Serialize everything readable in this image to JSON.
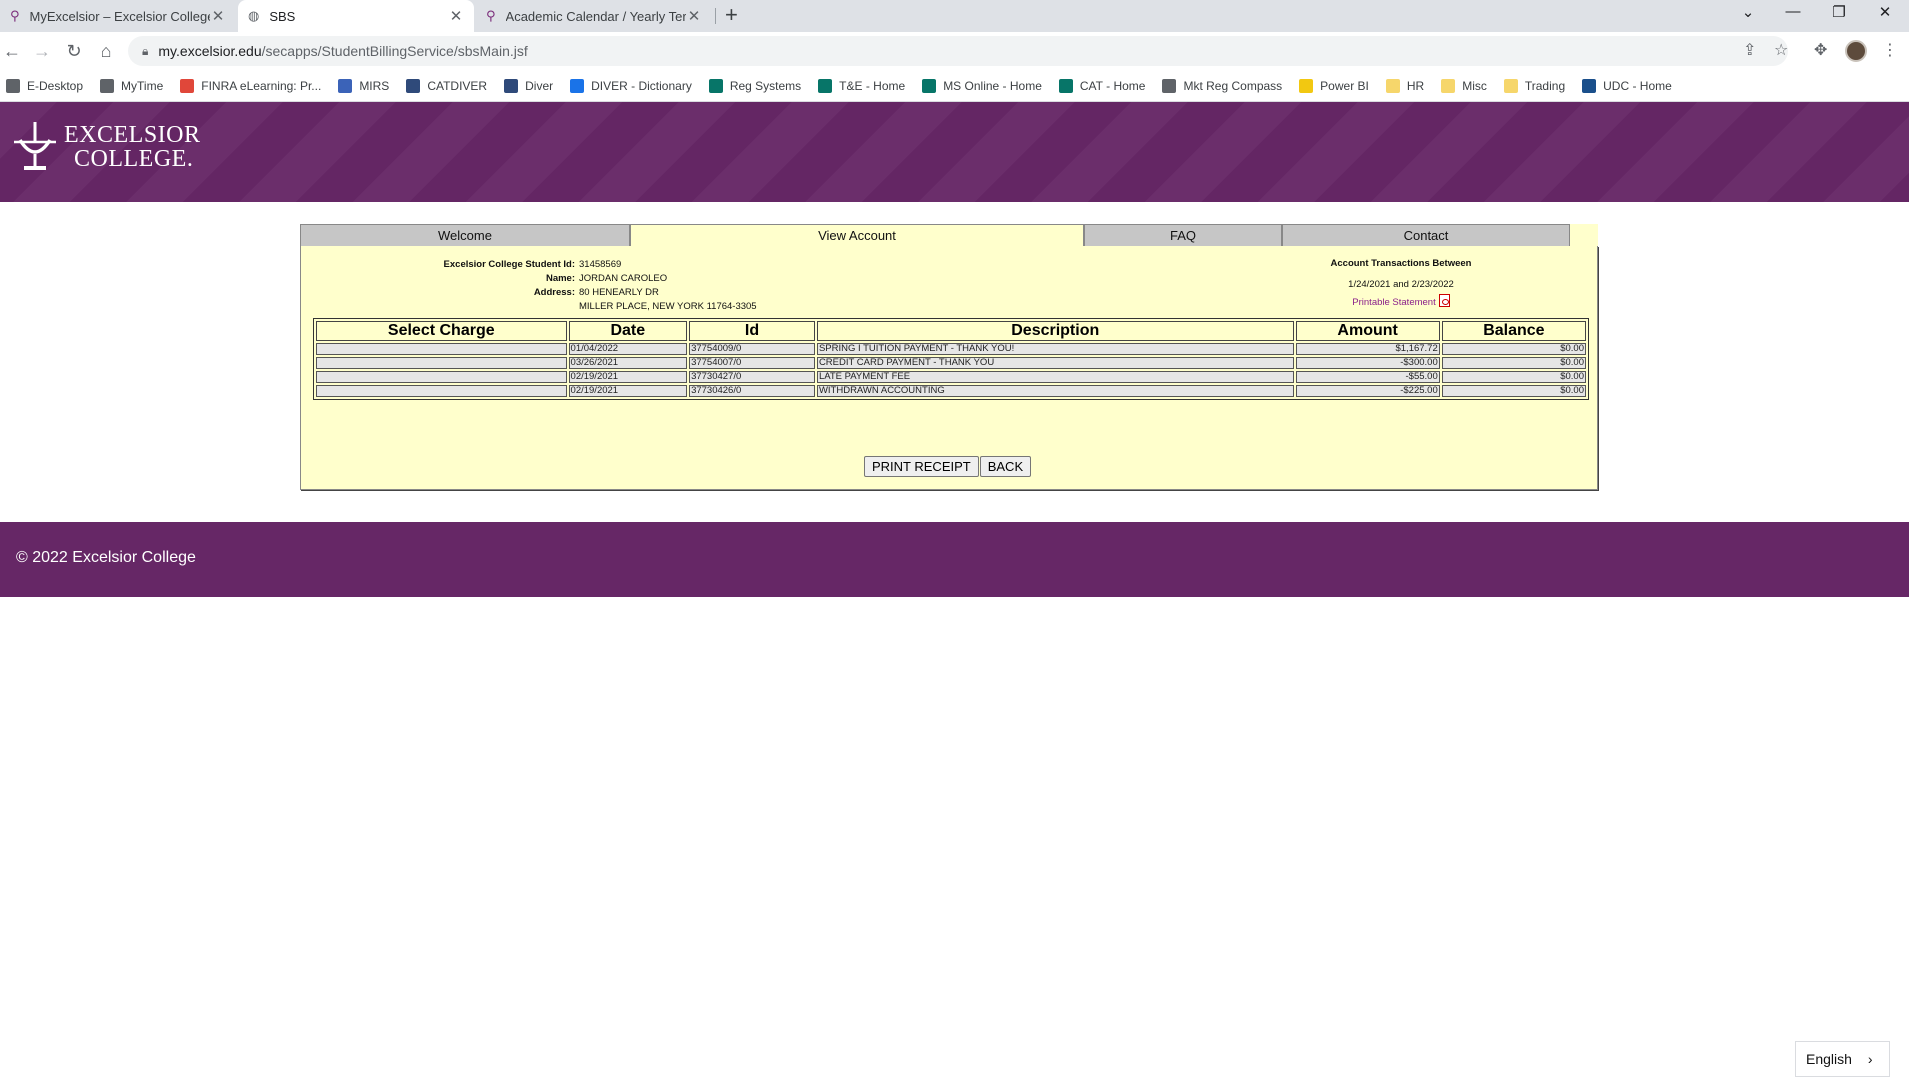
{
  "browser": {
    "tabs": [
      {
        "title": "MyExcelsior – Excelsior College",
        "close": "✕"
      },
      {
        "title": "SBS",
        "close": "✕"
      },
      {
        "title": "Academic Calendar / Yearly Term",
        "close": "✕"
      }
    ],
    "new_tab": "+",
    "window_controls": {
      "dropdown": "⌄",
      "minimize": "—",
      "restore": "❐",
      "close": "✕"
    },
    "nav": {
      "back": "←",
      "forward": "→",
      "reload": "↻",
      "home": "⌂"
    },
    "url_host": "my.excelsior.edu",
    "url_path": "/secapps/StudentBillingService/sbsMain.jsf",
    "bookmarks": [
      {
        "label": "E-Desktop",
        "color": "#5f6368"
      },
      {
        "label": "MyTime",
        "color": "#5f6368"
      },
      {
        "label": "FINRA eLearning: Pr...",
        "color": "#e0473a"
      },
      {
        "label": "MIRS",
        "color": "#3b63b8"
      },
      {
        "label": "CATDIVER",
        "color": "#2f4a7a"
      },
      {
        "label": "Diver",
        "color": "#2f4a7a"
      },
      {
        "label": "DIVER - Dictionary",
        "color": "#1a73e8"
      },
      {
        "label": "Reg Systems",
        "color": "#077568"
      },
      {
        "label": "T&E - Home",
        "color": "#077568"
      },
      {
        "label": "MS Online - Home",
        "color": "#077568"
      },
      {
        "label": "CAT - Home",
        "color": "#077568"
      },
      {
        "label": "Mkt Reg Compass",
        "color": "#5f6368"
      },
      {
        "label": "Power BI",
        "color": "#f2c811"
      },
      {
        "label": "HR",
        "color": "#f6d66b"
      },
      {
        "label": "Misc",
        "color": "#f6d66b"
      },
      {
        "label": "Trading",
        "color": "#f6d66b"
      },
      {
        "label": "UDC - Home",
        "color": "#1a4f8b"
      }
    ]
  },
  "site": {
    "logo_line1": "EXCELSIOR",
    "logo_line2": "COLLEGE.",
    "brand_color": "#662766",
    "footer": "© 2022 Excelsior College",
    "language": "English"
  },
  "nav_tabs": [
    "Welcome",
    "View Account",
    "FAQ",
    "Contact"
  ],
  "student": {
    "id_label": "Excelsior College Student Id:",
    "id": "31458569",
    "name_label": "Name:",
    "name": "JORDAN CAROLEO",
    "address_label": "Address:",
    "address1": "80 HENEARLY DR",
    "address2": "MILLER PLACE, NEW YORK 11764-3305"
  },
  "account": {
    "title": "Account Transactions Between",
    "range": "1/24/2021 and 2/23/2022",
    "printable": "Printable Statement"
  },
  "table": {
    "headers": [
      "Select Charge",
      "Date",
      "Id",
      "Description",
      "Amount",
      "Balance"
    ],
    "rows": [
      {
        "select": "",
        "date": "01/04/2022",
        "id": "37754009/0",
        "description": "SPRING I TUITION PAYMENT - THANK YOU!",
        "amount": "$1,167.72",
        "balance": "$0.00"
      },
      {
        "select": "",
        "date": "03/26/2021",
        "id": "37754007/0",
        "description": "CREDIT CARD PAYMENT - THANK YOU",
        "amount": "-$300.00",
        "balance": "$0.00"
      },
      {
        "select": "",
        "date": "02/19/2021",
        "id": "37730427/0",
        "description": "LATE PAYMENT FEE",
        "amount": "-$55.00",
        "balance": "$0.00"
      },
      {
        "select": "",
        "date": "02/19/2021",
        "id": "37730426/0",
        "description": "WITHDRAWN ACCOUNTING",
        "amount": "-$225.00",
        "balance": "$0.00"
      }
    ]
  },
  "buttons": {
    "print": "PRINT RECEIPT",
    "back": "BACK"
  }
}
